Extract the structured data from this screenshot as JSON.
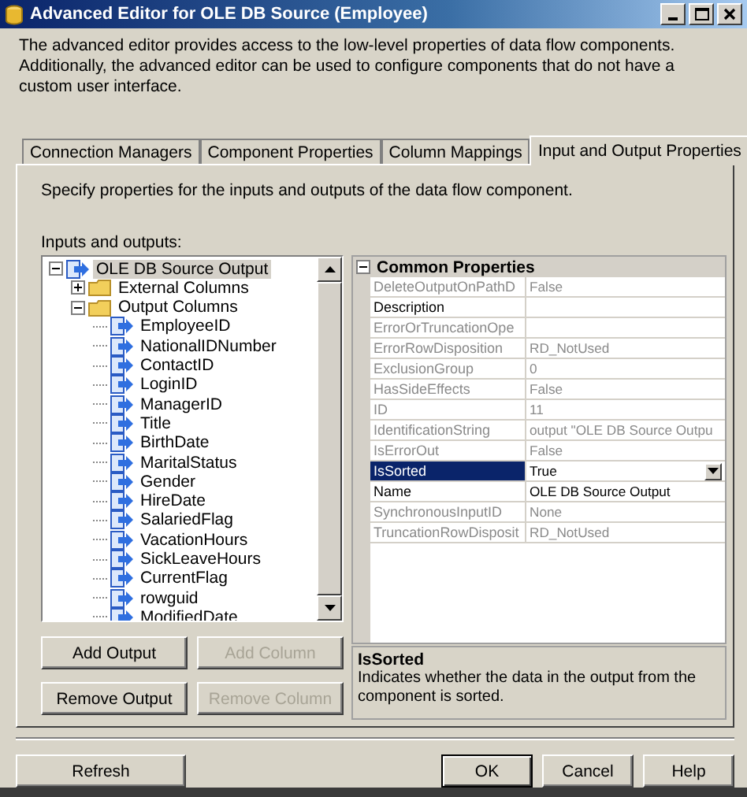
{
  "window": {
    "title": "Advanced Editor for OLE DB Source (Employee)"
  },
  "description": "The advanced editor provides access to the low-level properties of data flow components. Additionally, the advanced editor can be used to configure components that do not have a custom user interface.",
  "tabs": [
    {
      "label": "Connection Managers",
      "selected": false
    },
    {
      "label": "Component Properties",
      "selected": false
    },
    {
      "label": "Column Mappings",
      "selected": false
    },
    {
      "label": "Input and Output Properties",
      "selected": true
    }
  ],
  "tab_panel": {
    "instruction": "Specify properties for the inputs and outputs of the data flow component.",
    "tree_label": "Inputs and outputs:",
    "tree": [
      {
        "label": "OLE DB Source Output",
        "kind": "output",
        "selected": true,
        "expanded": true,
        "children": [
          {
            "label": "External Columns",
            "kind": "folder",
            "selected": false,
            "expanded": false
          },
          {
            "label": "Output Columns",
            "kind": "folder",
            "selected": false,
            "expanded": true,
            "children": [
              {
                "label": "EmployeeID",
                "kind": "column",
                "selected": false
              },
              {
                "label": "NationalIDNumber",
                "kind": "column",
                "selected": false
              },
              {
                "label": "ContactID",
                "kind": "column",
                "selected": false
              },
              {
                "label": "LoginID",
                "kind": "column",
                "selected": false
              },
              {
                "label": "ManagerID",
                "kind": "column",
                "selected": false
              },
              {
                "label": "Title",
                "kind": "column",
                "selected": false
              },
              {
                "label": "BirthDate",
                "kind": "column",
                "selected": false
              },
              {
                "label": "MaritalStatus",
                "kind": "column",
                "selected": false
              },
              {
                "label": "Gender",
                "kind": "column",
                "selected": false
              },
              {
                "label": "HireDate",
                "kind": "column",
                "selected": false
              },
              {
                "label": "SalariedFlag",
                "kind": "column",
                "selected": false
              },
              {
                "label": "VacationHours",
                "kind": "column",
                "selected": false
              },
              {
                "label": "SickLeaveHours",
                "kind": "column",
                "selected": false
              },
              {
                "label": "CurrentFlag",
                "kind": "column",
                "selected": false
              },
              {
                "label": "rowguid",
                "kind": "column",
                "selected": false
              },
              {
                "label": "ModifiedDate",
                "kind": "column",
                "selected": false
              }
            ]
          }
        ]
      }
    ],
    "tree_buttons": [
      {
        "label": "Add Output",
        "disabled": false
      },
      {
        "label": "Add Column",
        "disabled": true
      },
      {
        "label": "Remove Output",
        "disabled": false
      },
      {
        "label": "Remove Column",
        "disabled": true
      }
    ],
    "property_grid": {
      "category": {
        "label": "Common Properties",
        "expanded": true
      },
      "rows": [
        {
          "name": "DeleteOutputOnPathD",
          "value": "False",
          "disabled": true,
          "selected": false
        },
        {
          "name": "Description",
          "disabled": false,
          "selected": false
        },
        {
          "name": "ErrorOrTruncationOpe",
          "disabled": true,
          "selected": false
        },
        {
          "name": "ErrorRowDisposition",
          "value": "RD_NotUsed",
          "disabled": true,
          "selected": false
        },
        {
          "name": "ExclusionGroup",
          "value": "0",
          "disabled": true,
          "selected": false
        },
        {
          "name": "HasSideEffects",
          "value": "False",
          "disabled": true,
          "selected": false
        },
        {
          "name": "ID",
          "value": "11",
          "disabled": true,
          "selected": false
        },
        {
          "name": "IdentificationString",
          "value": "output \"OLE DB Source Outpu",
          "disabled": true,
          "selected": false
        },
        {
          "name": "IsErrorOut",
          "value": "False",
          "disabled": true,
          "selected": false
        },
        {
          "name": "IsSorted",
          "value": "True",
          "disabled": false,
          "selected": true
        },
        {
          "name": "Name",
          "value": "OLE DB Source Output",
          "disabled": false,
          "selected": false
        },
        {
          "name": "SynchronousInputID",
          "value": "None",
          "disabled": true,
          "selected": false
        },
        {
          "name": "TruncationRowDisposit",
          "value": "RD_NotUsed",
          "disabled": true,
          "selected": false
        }
      ]
    },
    "help": {
      "title": "IsSorted",
      "text": "Indicates whether the data in the output from the component is sorted."
    }
  },
  "footer_buttons": [
    {
      "label": "Refresh",
      "default": false
    },
    {
      "label": "OK",
      "default": true
    },
    {
      "label": "Cancel",
      "default": false
    },
    {
      "label": "Help",
      "default": false
    }
  ]
}
